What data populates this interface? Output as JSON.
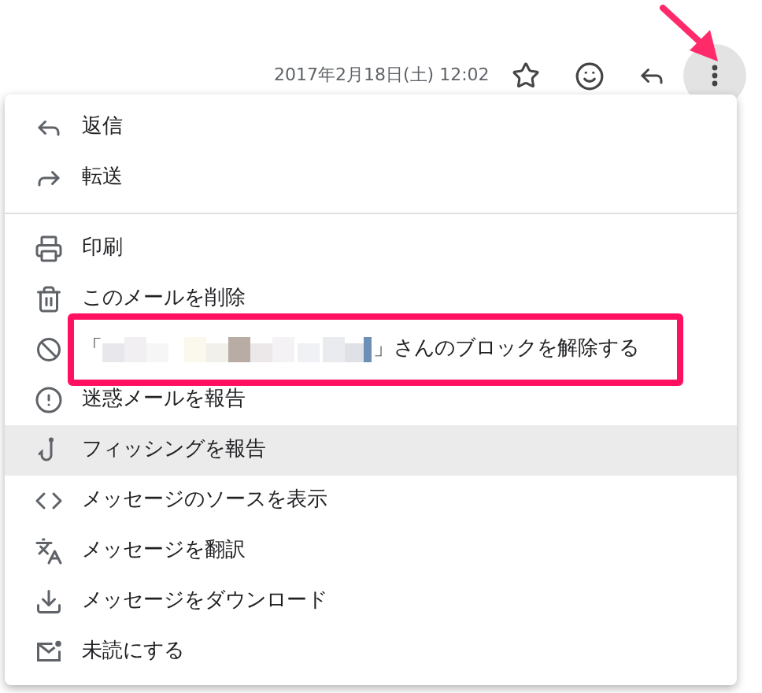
{
  "header": {
    "date": "2017年2月18日(土) 12:02",
    "more_pointed": true
  },
  "menu": {
    "groups": [
      [
        {
          "kind": "action",
          "label": "返信",
          "hovered": false,
          "annotated": false
        },
        {
          "kind": "action",
          "label": "転送",
          "hovered": false,
          "annotated": false
        }
      ],
      [
        {
          "kind": "action",
          "label": "印刷",
          "hovered": false,
          "annotated": false
        },
        {
          "kind": "action",
          "label": "このメールを削除",
          "hovered": false,
          "annotated": false
        },
        {
          "kind": "blocked-sender",
          "prefix": "「",
          "label": "」さんのブロックを解除する",
          "hovered": false,
          "annotated": true
        },
        {
          "kind": "action",
          "label": "迷惑メールを報告",
          "hovered": false,
          "annotated": false
        },
        {
          "kind": "action",
          "label": "フィッシングを報告",
          "hovered": true,
          "annotated": false
        },
        {
          "kind": "action",
          "label": "メッセージのソースを表示",
          "hovered": false,
          "annotated": false
        },
        {
          "kind": "action",
          "label": "メッセージを翻訳",
          "hovered": false,
          "annotated": false
        },
        {
          "kind": "action",
          "label": "メッセージをダウンロード",
          "hovered": false,
          "annotated": false
        },
        {
          "kind": "action",
          "label": "未読にする",
          "hovered": false,
          "annotated": false
        }
      ]
    ]
  }
}
